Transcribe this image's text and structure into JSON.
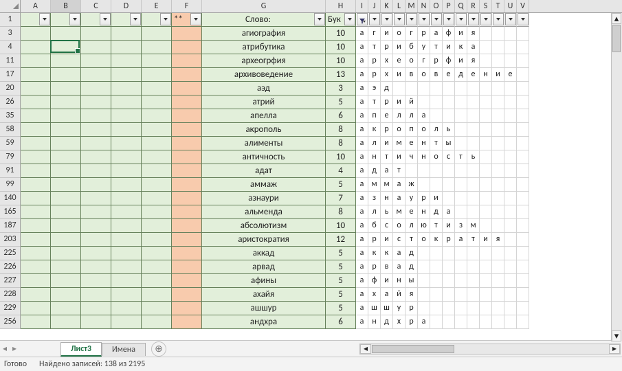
{
  "colWidths": {
    "rowhdr": 30,
    "A": 44,
    "B": 44,
    "C": 44,
    "D": 44,
    "E": 44,
    "F": 44,
    "G": 180,
    "H": 44,
    "letter": 18
  },
  "letterCols": [
    "I",
    "J",
    "K",
    "L",
    "M",
    "N",
    "O",
    "P",
    "Q",
    "R",
    "S",
    "T",
    "U",
    "V"
  ],
  "selectedColumn": "B",
  "selectionAddress": "B4",
  "headerRow": {
    "rowNumber": 1,
    "F": "**",
    "G": "Слово:",
    "H": "Бук",
    "filtered": [
      "I"
    ]
  },
  "rows": [
    {
      "n": 3,
      "word": "агиография",
      "len": 10,
      "letters": [
        "а",
        "г",
        "и",
        "о",
        "г",
        "р",
        "а",
        "ф",
        "и",
        "я"
      ]
    },
    {
      "n": 4,
      "word": "атрибутика",
      "len": 10,
      "letters": [
        "а",
        "т",
        "р",
        "и",
        "б",
        "у",
        "т",
        "и",
        "к",
        "а"
      ]
    },
    {
      "n": 11,
      "word": "археогрфия",
      "len": 10,
      "letters": [
        "а",
        "р",
        "х",
        "е",
        "о",
        "г",
        "р",
        "ф",
        "и",
        "я"
      ]
    },
    {
      "n": 17,
      "word": "архивоведение",
      "len": 13,
      "letters": [
        "а",
        "р",
        "х",
        "и",
        "в",
        "о",
        "в",
        "е",
        "д",
        "е",
        "н",
        "и",
        "е"
      ]
    },
    {
      "n": 20,
      "word": "аэд",
      "len": 3,
      "letters": [
        "а",
        "э",
        "д"
      ]
    },
    {
      "n": 26,
      "word": "атрий",
      "len": 5,
      "letters": [
        "а",
        "т",
        "р",
        "и",
        "й"
      ]
    },
    {
      "n": 35,
      "word": "апелла",
      "len": 6,
      "letters": [
        "а",
        "п",
        "е",
        "л",
        "л",
        "а"
      ]
    },
    {
      "n": 58,
      "word": "акрополь",
      "len": 8,
      "letters": [
        "а",
        "к",
        "р",
        "о",
        "п",
        "о",
        "л",
        "ь"
      ]
    },
    {
      "n": 59,
      "word": "алименты",
      "len": 8,
      "letters": [
        "а",
        "л",
        "и",
        "м",
        "е",
        "н",
        "т",
        "ы"
      ]
    },
    {
      "n": 79,
      "word": "античность",
      "len": 10,
      "letters": [
        "а",
        "н",
        "т",
        "и",
        "ч",
        "н",
        "о",
        "с",
        "т",
        "ь"
      ]
    },
    {
      "n": 91,
      "word": "адат",
      "len": 4,
      "letters": [
        "а",
        "д",
        "а",
        "т"
      ]
    },
    {
      "n": 99,
      "word": "аммаж",
      "len": 5,
      "letters": [
        "а",
        "м",
        "м",
        "а",
        "ж"
      ]
    },
    {
      "n": 140,
      "word": "азнаури",
      "len": 7,
      "letters": [
        "а",
        "з",
        "н",
        "а",
        "у",
        "р",
        "и"
      ]
    },
    {
      "n": 165,
      "word": "альменда",
      "len": 8,
      "letters": [
        "а",
        "л",
        "ь",
        "м",
        "е",
        "н",
        "д",
        "а"
      ]
    },
    {
      "n": 187,
      "word": "абсолютизм",
      "len": 10,
      "letters": [
        "а",
        "б",
        "с",
        "о",
        "л",
        "ю",
        "т",
        "и",
        "з",
        "м"
      ]
    },
    {
      "n": 203,
      "word": "аристократия",
      "len": 12,
      "letters": [
        "а",
        "р",
        "и",
        "с",
        "т",
        "о",
        "к",
        "р",
        "а",
        "т",
        "и",
        "я"
      ]
    },
    {
      "n": 225,
      "word": "аккад",
      "len": 5,
      "letters": [
        "а",
        "к",
        "к",
        "а",
        "д"
      ]
    },
    {
      "n": 226,
      "word": "арвад",
      "len": 5,
      "letters": [
        "а",
        "р",
        "в",
        "а",
        "д"
      ]
    },
    {
      "n": 227,
      "word": "афины",
      "len": 5,
      "letters": [
        "а",
        "ф",
        "и",
        "н",
        "ы"
      ]
    },
    {
      "n": 228,
      "word": "ахайя",
      "len": 5,
      "letters": [
        "а",
        "х",
        "а",
        "й",
        "я"
      ]
    },
    {
      "n": 229,
      "word": "ашшур",
      "len": 5,
      "letters": [
        "а",
        "ш",
        "ш",
        "у",
        "р"
      ]
    },
    {
      "n": 256,
      "word": "андхра",
      "len": 6,
      "letters": [
        "а",
        "н",
        "д",
        "х",
        "р",
        "а"
      ]
    }
  ],
  "tabs": {
    "active": "Лист3",
    "inactive": "Имена"
  },
  "status": {
    "ready": "Готово",
    "found": "Найдено записей: 138 из 2195"
  }
}
